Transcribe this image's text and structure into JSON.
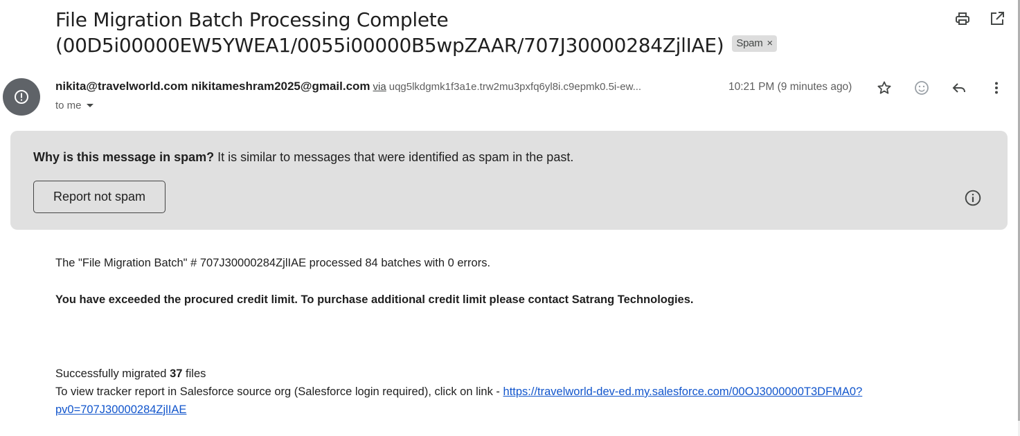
{
  "email": {
    "subject_line1": "File Migration Batch Processing Complete",
    "subject_line2": "(00D5i00000EW5YWEA1/0055i00000B5wpZAAR/707J30000284ZjlIAE)",
    "label_chip": "Spam",
    "label_chip_close": "×",
    "sender_name": "nikita@travelworld.com nikitameshram2025@gmail.com",
    "via_label": "via",
    "via_address": "uqg5lkdgmk1f3a1e.trw2mu3pxfq6yl8i.c9epmk0.5i-ew...",
    "recipient": "to me",
    "timestamp": "10:21 PM (9 minutes ago)"
  },
  "icons": {
    "top": [
      "print-icon",
      "open-in-new-window-icon"
    ],
    "message_actions": [
      "star-icon",
      "emoji-reaction-icon",
      "reply-icon",
      "more-options-icon"
    ],
    "avatar": "spam-warning-icon"
  },
  "spam_notice": {
    "question": "Why is this message in spam?",
    "explanation": " It is similar to messages that were identified as spam in the past.",
    "button_label": "Report not spam"
  },
  "body": {
    "line1": "The \"File Migration Batch\" # 707J30000284ZjlIAE processed 84 batches with 0 errors.",
    "line2": "You have exceeded the procured credit limit. To purchase additional credit limit please contact Satrang Technologies.",
    "migrated_prefix": "Successfully migrated ",
    "migrated_count": "37",
    "migrated_suffix": " files",
    "tracker_text": "To view tracker report in Salesforce source org (Salesforce login required), click on link - ",
    "tracker_link": "https://travelworld-dev-ed.my.salesforce.com/00OJ3000000T3DFMA0?pv0=707J30000284ZjlIAE"
  },
  "colors": {
    "avatar_bg": "#5f6368",
    "spam_box_bg": "#e0e0e0",
    "link": "#1155cc",
    "chip_bg": "#dddddd"
  }
}
